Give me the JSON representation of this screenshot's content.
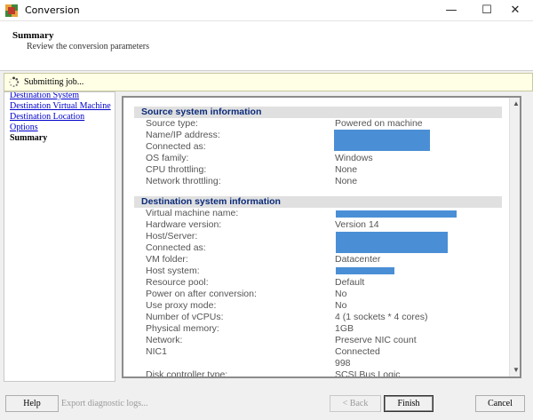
{
  "window": {
    "title": "Conversion",
    "icon": "vmware-converter-icon"
  },
  "header": {
    "title": "Summary",
    "subtitle": "Review the conversion parameters"
  },
  "status": {
    "text": "Submitting job..."
  },
  "nav": {
    "items": [
      {
        "label": "Destination System"
      },
      {
        "label": "Destination Virtual Machine"
      },
      {
        "label": "Destination Location"
      },
      {
        "label": "Options"
      },
      {
        "label": "Summary"
      }
    ]
  },
  "source": {
    "title": "Source system information",
    "rows": [
      {
        "label": "Source type:",
        "value": "Powered on machine"
      },
      {
        "label": "Name/IP address:",
        "value": ""
      },
      {
        "label": "Connected as:",
        "value": ""
      },
      {
        "label": "OS family:",
        "value": "Windows"
      },
      {
        "label": "CPU throttling:",
        "value": "None"
      },
      {
        "label": "Network throttling:",
        "value": "None"
      }
    ]
  },
  "destination": {
    "title": "Destination system information",
    "rows": [
      {
        "label": "Virtual machine name:",
        "value": ""
      },
      {
        "label": "Hardware version:",
        "value": "Version 14"
      },
      {
        "label": "Host/Server:",
        "value": ""
      },
      {
        "label": "Connected as:",
        "value": ""
      },
      {
        "label": "VM folder:",
        "value": "Datacenter"
      },
      {
        "label": "Host system:",
        "value": ""
      },
      {
        "label": "Resource pool:",
        "value": "Default"
      },
      {
        "label": "Power on after conversion:",
        "value": "No"
      },
      {
        "label": "Use proxy mode:",
        "value": "No"
      },
      {
        "label": "Number of vCPUs:",
        "value": "4 (1 sockets * 4 cores)"
      },
      {
        "label": "Physical memory:",
        "value": "1GB"
      },
      {
        "label": "Network:",
        "value": "Preserve NIC count"
      },
      {
        "label": "NIC1",
        "value": "Connected"
      },
      {
        "label": "",
        "value": "998"
      },
      {
        "label": "Disk controller type:",
        "value": "SCSI Bus Logic"
      }
    ]
  },
  "footer": {
    "help_label": "Help",
    "export_label": "Export diagnostic logs...",
    "back_label": "< Back",
    "finish_label": "Finish",
    "cancel_label": "Cancel"
  },
  "colors": {
    "section_header_bg": "#e0e0e0",
    "section_header_text": "#0a2a7a",
    "redaction": "#4a8fd6",
    "status_bg": "#ffffe6"
  }
}
